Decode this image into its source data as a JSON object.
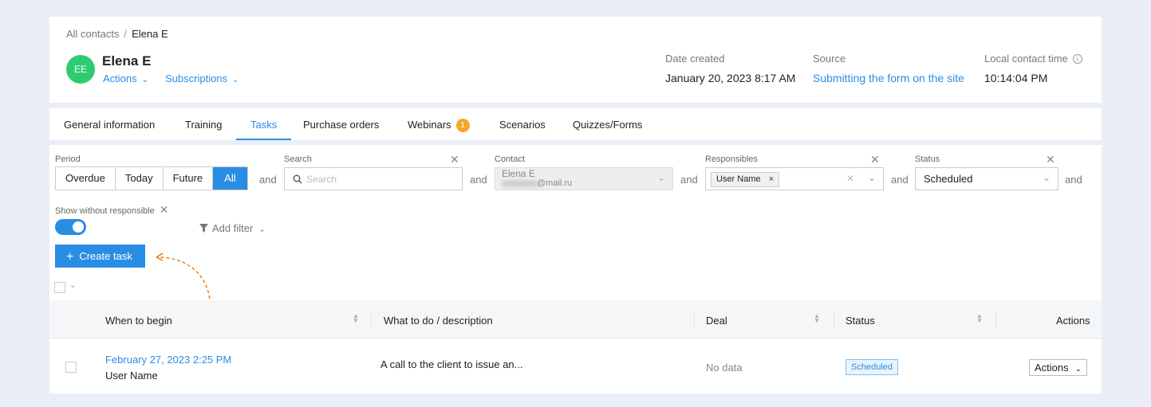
{
  "breadcrumb": {
    "root": "All contacts",
    "separator": "/",
    "current": "Elena E"
  },
  "contact": {
    "initials": "EE",
    "name": "Elena E",
    "actions_label": "Actions",
    "subscriptions_label": "Subscriptions",
    "date_created_label": "Date created",
    "date_created_value": "January 20, 2023 8:17 AM",
    "source_label": "Source",
    "source_value": "Submitting the form on the site",
    "local_time_label": "Local contact time",
    "local_time_value": "10:14:04 PM"
  },
  "tabs": [
    {
      "label": "General information"
    },
    {
      "label": "Training"
    },
    {
      "label": "Tasks",
      "active": true
    },
    {
      "label": "Purchase orders"
    },
    {
      "label": "Webinars",
      "badge": "1"
    },
    {
      "label": "Scenarios"
    },
    {
      "label": "Quizzes/Forms"
    }
  ],
  "filters": {
    "period_label": "Period",
    "period_options": [
      "Overdue",
      "Today",
      "Future",
      "All"
    ],
    "period_selected": "All",
    "and": "and",
    "search_label": "Search",
    "search_placeholder": "Search",
    "contact_label": "Contact",
    "contact_name": "Elena E",
    "contact_email": "@mail.ru",
    "responsibles_label": "Responsibles",
    "responsible_chip": "User Name",
    "status_label": "Status",
    "status_value": "Scheduled",
    "show_without_responsible_label": "Show without responsible",
    "show_without_responsible_on": true,
    "add_filter_label": "Add filter"
  },
  "create_task_label": "Create task",
  "table": {
    "columns": [
      "When to begin",
      "What to do / description",
      "Deal",
      "Status",
      "Actions"
    ],
    "rows": [
      {
        "when": "February 27, 2023 2:25 PM",
        "user": "User Name",
        "description": "A call to the client to issue an...",
        "deal": "No data",
        "status": "Scheduled",
        "actions": "Actions"
      }
    ]
  },
  "colors": {
    "accent": "#2a8de5",
    "avatar": "#2ecc71",
    "badge": "#f5a623",
    "annotation_arrow": "#e8892b"
  }
}
